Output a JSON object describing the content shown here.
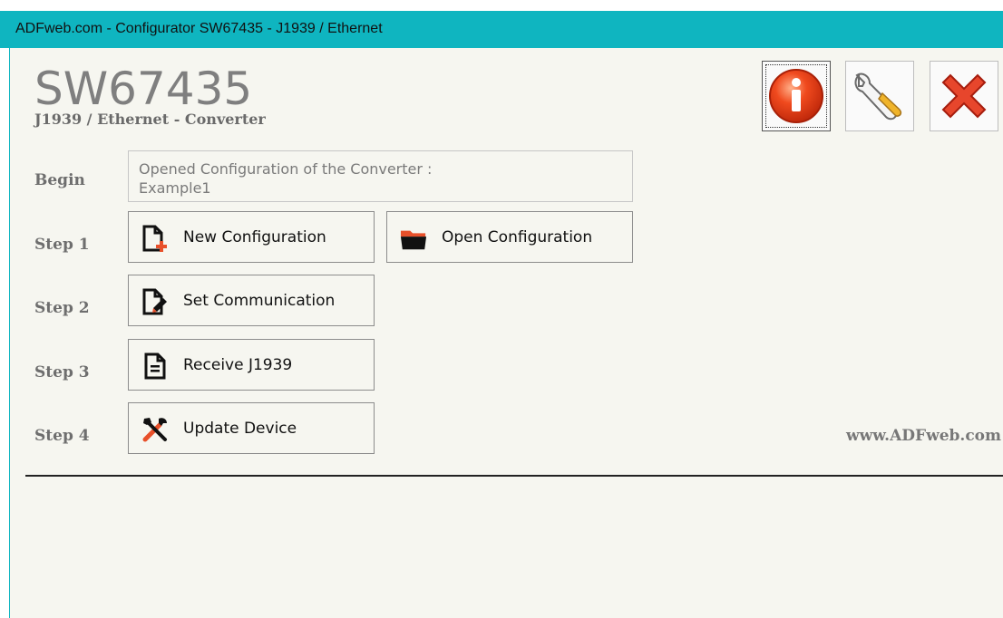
{
  "window": {
    "title": "ADFweb.com - Configurator SW67435 - J1939 / Ethernet"
  },
  "header": {
    "product_code": "SW67435",
    "product_subtitle": "J1939 / Ethernet - Converter"
  },
  "toolbar": {
    "info_icon": "info-icon",
    "settings_icon": "wrench-icon",
    "close_icon": "close-icon"
  },
  "steps": {
    "begin_label": "Begin",
    "begin_info_line1": "Opened Configuration of the Converter :",
    "begin_info_line2": "Example1",
    "step1_label": "Step 1",
    "step2_label": "Step 2",
    "step3_label": "Step 3",
    "step4_label": "Step 4",
    "new_config": "New Configuration",
    "open_config": "Open Configuration",
    "set_communication": "Set Communication",
    "receive_j1939": "Receive J1939",
    "update_device": "Update Device"
  },
  "footer": {
    "website": "www.ADFweb.com"
  },
  "colors": {
    "titlebar": "#0fb5c0",
    "background": "#f6f6f0",
    "accent": "#e8502a"
  }
}
